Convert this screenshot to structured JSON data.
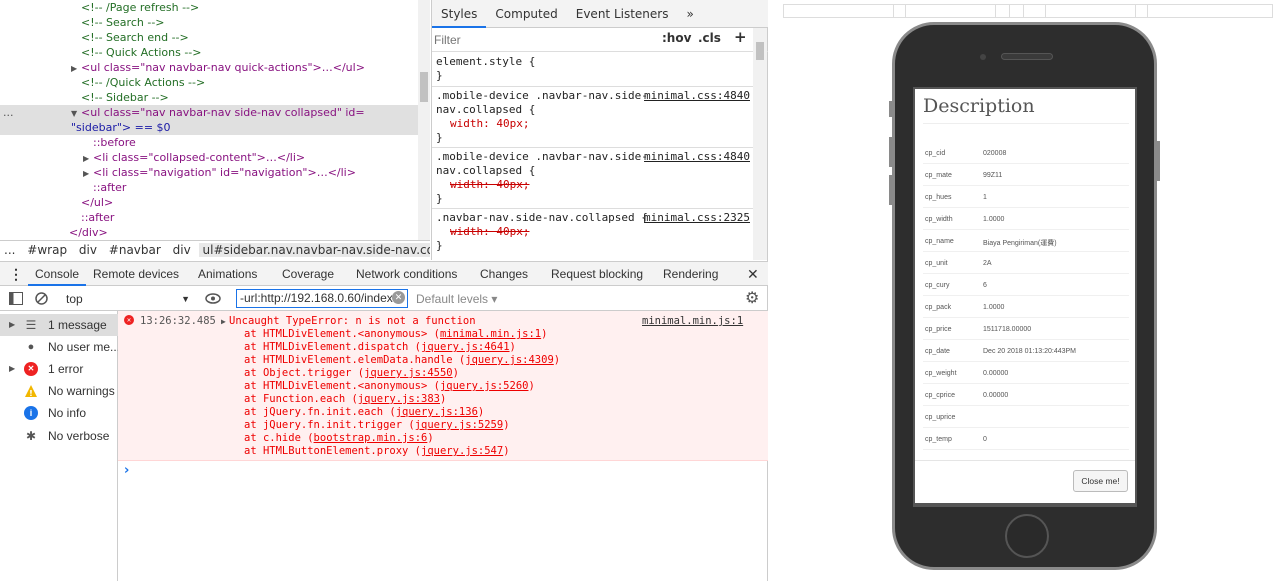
{
  "elements_panel": {
    "lines": [
      "<!-- /Page refresh -->",
      "<!-- Search -->",
      "<!-- Search end -->",
      "<!-- Quick Actions -->",
      "<ul class=\"nav navbar-nav quick-actions\">…</ul>",
      "<!-- /Quick Actions -->",
      "<!-- Sidebar -->",
      "<ul class=\"nav navbar-nav side-nav collapsed\" id=",
      "\"sidebar\"> == $0",
      "::before",
      "<li class=\"collapsed-content\">…</li>",
      "<li class=\"navigation\" id=\"navigation\">…</li>",
      "::after",
      "</ul>",
      "::after",
      "</div>"
    ],
    "ellipsis": "..."
  },
  "breadcrumb": {
    "ellipsis": "...",
    "items": [
      "#wrap",
      "div",
      "#navbar",
      "div",
      "ul#sidebar.nav.navbar-nav.side-nav.collapsed"
    ]
  },
  "styles_panel": {
    "tabs": [
      "Styles",
      "Computed",
      "Event Listeners"
    ],
    "more": "»",
    "filter_placeholder": "Filter",
    "hov": ":hov",
    "cls": ".cls",
    "plus": "+",
    "rules": [
      {
        "selector": "element.style {",
        "source": "",
        "props": [],
        "close": "}"
      },
      {
        "selector": ".mobile-device .navbar-nav.side-",
        "selector2": "nav.collapsed {",
        "source": "minimal.css:4840",
        "props": [
          {
            "text": "width: 40px;",
            "struck": false
          }
        ],
        "close": "}"
      },
      {
        "selector": ".mobile-device .navbar-nav.side-",
        "selector2": "nav.collapsed {",
        "source": "minimal.css:4840",
        "props": [
          {
            "text": "width: 40px;",
            "struck": true
          }
        ],
        "close": "}"
      },
      {
        "selector": ".navbar-nav.side-nav.collapsed {",
        "source": "minimal.css:2325",
        "props": [
          {
            "text": "width: 40px;",
            "struck": true
          }
        ],
        "close": "}"
      }
    ]
  },
  "drawer": {
    "tabs": [
      "Console",
      "Remote devices",
      "Animations",
      "Coverage",
      "Network conditions",
      "Changes",
      "Request blocking",
      "Rendering"
    ],
    "active_tab": "Console",
    "close": "✕",
    "menu": "⋮"
  },
  "console_toolbar": {
    "context": "top",
    "filter_value": "-url:http://192.168.0.60/index",
    "levels": "Default levels ▾"
  },
  "console_sidebar": {
    "items": [
      {
        "label": "1 message",
        "icon": "list-icon",
        "glyph": "☰",
        "arrow": true,
        "color": "#555"
      },
      {
        "label": "No user me...",
        "icon": "user-icon",
        "glyph": "●",
        "arrow": false,
        "color": "#555"
      },
      {
        "label": "1 error",
        "icon": "error-icon",
        "glyph": "✕",
        "arrow": true,
        "color": "#e22"
      },
      {
        "label": "No warnings",
        "icon": "warning-icon",
        "glyph": "!",
        "arrow": false,
        "color": "#f2b700"
      },
      {
        "label": "No info",
        "icon": "info-icon",
        "glyph": "i",
        "arrow": false,
        "color": "#1a73e8"
      },
      {
        "label": "No verbose",
        "icon": "bug-icon",
        "glyph": "✱",
        "arrow": false,
        "color": "#555"
      }
    ]
  },
  "console_error": {
    "timestamp": "13:26:32.485",
    "message": "Uncaught TypeError: n is not a function",
    "source": "minimal.min.js:1",
    "stack": [
      {
        "text": "at HTMLDivElement.<anonymous> (",
        "link": "minimal.min.js:1",
        "end": ")"
      },
      {
        "text": "at HTMLDivElement.dispatch (",
        "link": "jquery.js:4641",
        "end": ")"
      },
      {
        "text": "at HTMLDivElement.elemData.handle (",
        "link": "jquery.js:4309",
        "end": ")"
      },
      {
        "text": "at Object.trigger (",
        "link": "jquery.js:4550",
        "end": ")"
      },
      {
        "text": "at HTMLDivElement.<anonymous> (",
        "link": "jquery.js:5260",
        "end": ")"
      },
      {
        "text": "at Function.each (",
        "link": "jquery.js:383",
        "end": ")"
      },
      {
        "text": "at jQuery.fn.init.each (",
        "link": "jquery.js:136",
        "end": ")"
      },
      {
        "text": "at jQuery.fn.init.trigger (",
        "link": "jquery.js:5259",
        "end": ")"
      },
      {
        "text": "at c.hide (",
        "link": "bootstrap.min.js:6",
        "end": ")"
      },
      {
        "text": "at HTMLButtonElement.proxy (",
        "link": "jquery.js:547",
        "end": ")"
      }
    ],
    "prompt": "›"
  },
  "modal": {
    "title": "Description",
    "rows": [
      {
        "key": "cp_cid",
        "value": "020008"
      },
      {
        "key": "cp_mate",
        "value": "99Z11"
      },
      {
        "key": "cp_hues",
        "value": "1"
      },
      {
        "key": "cp_width",
        "value": "1.0000"
      },
      {
        "key": "cp_name",
        "value": "Biaya Pengiriman(運費)"
      },
      {
        "key": "cp_unit",
        "value": "2A"
      },
      {
        "key": "cp_cury",
        "value": "6"
      },
      {
        "key": "cp_pack",
        "value": "1.0000"
      },
      {
        "key": "cp_price",
        "value": "1511718.00000"
      },
      {
        "key": "cp_date",
        "value": "Dec 20 2018 01:13:20:443PM"
      },
      {
        "key": "cp_weight",
        "value": "0.00000"
      },
      {
        "key": "cp_cprice",
        "value": "0.00000"
      },
      {
        "key": "cp_uprice",
        "value": ""
      },
      {
        "key": "cp_temp",
        "value": "0"
      }
    ],
    "close_label": "Close me!"
  },
  "colors": {
    "accent": "#1a73e8",
    "error_bg": "#fff0f0",
    "error_text": "#e00"
  }
}
